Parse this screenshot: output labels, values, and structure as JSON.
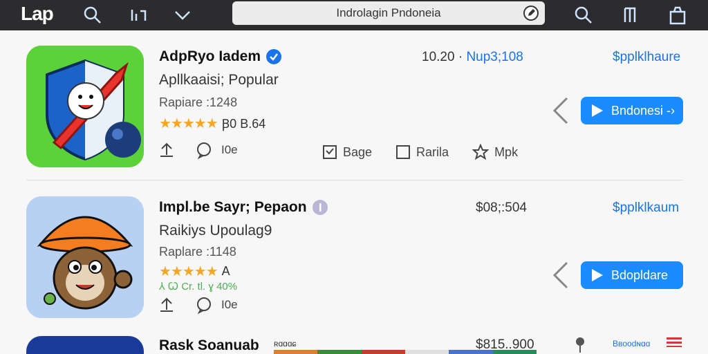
{
  "header": {
    "logo": "Lap",
    "search_query": "Indrolagin Pndoneia",
    "icons": [
      "search-icon",
      "chart-icon",
      "chevron-down-icon",
      "edit-icon",
      "search-icon",
      "bookmark-icon",
      "bag-icon"
    ]
  },
  "apps": [
    {
      "title": "AdpRyo Iadem",
      "subtitle": "Apllkaaisi; Popular",
      "rating_line": "Rapiare :1248",
      "stars_text": "Ꞵ0 B.64",
      "actions": {
        "count": "I0e"
      },
      "price_time": "10.20 ·",
      "price_blue": "Nup3;108",
      "link": "$pplklhaure",
      "get_label": "Bndonesi -›",
      "tools": [
        "Bage",
        "Rarila",
        "Mpk"
      ],
      "colors": {
        "icon_bg": "#5bd23a"
      }
    },
    {
      "title": "Impl.be Sayr; Pepaon",
      "subtitle": "Raikiys Upoulag9",
      "rating_line": "Raplare :1148",
      "stars_text": "A",
      "extra": "⅄ Ꞷ Cr. tl. ɣ 40%",
      "actions": {
        "count": "I0e"
      },
      "price_time": "$08;:504",
      "link": "$pplklkaum",
      "get_label": "Bdopldare"
    },
    {
      "title": "Rask Soanuab",
      "small_label": "ʀɑɑɑɕ",
      "price_time": "$815..900",
      "link": "Bʙoodɴɑɑ"
    }
  ]
}
